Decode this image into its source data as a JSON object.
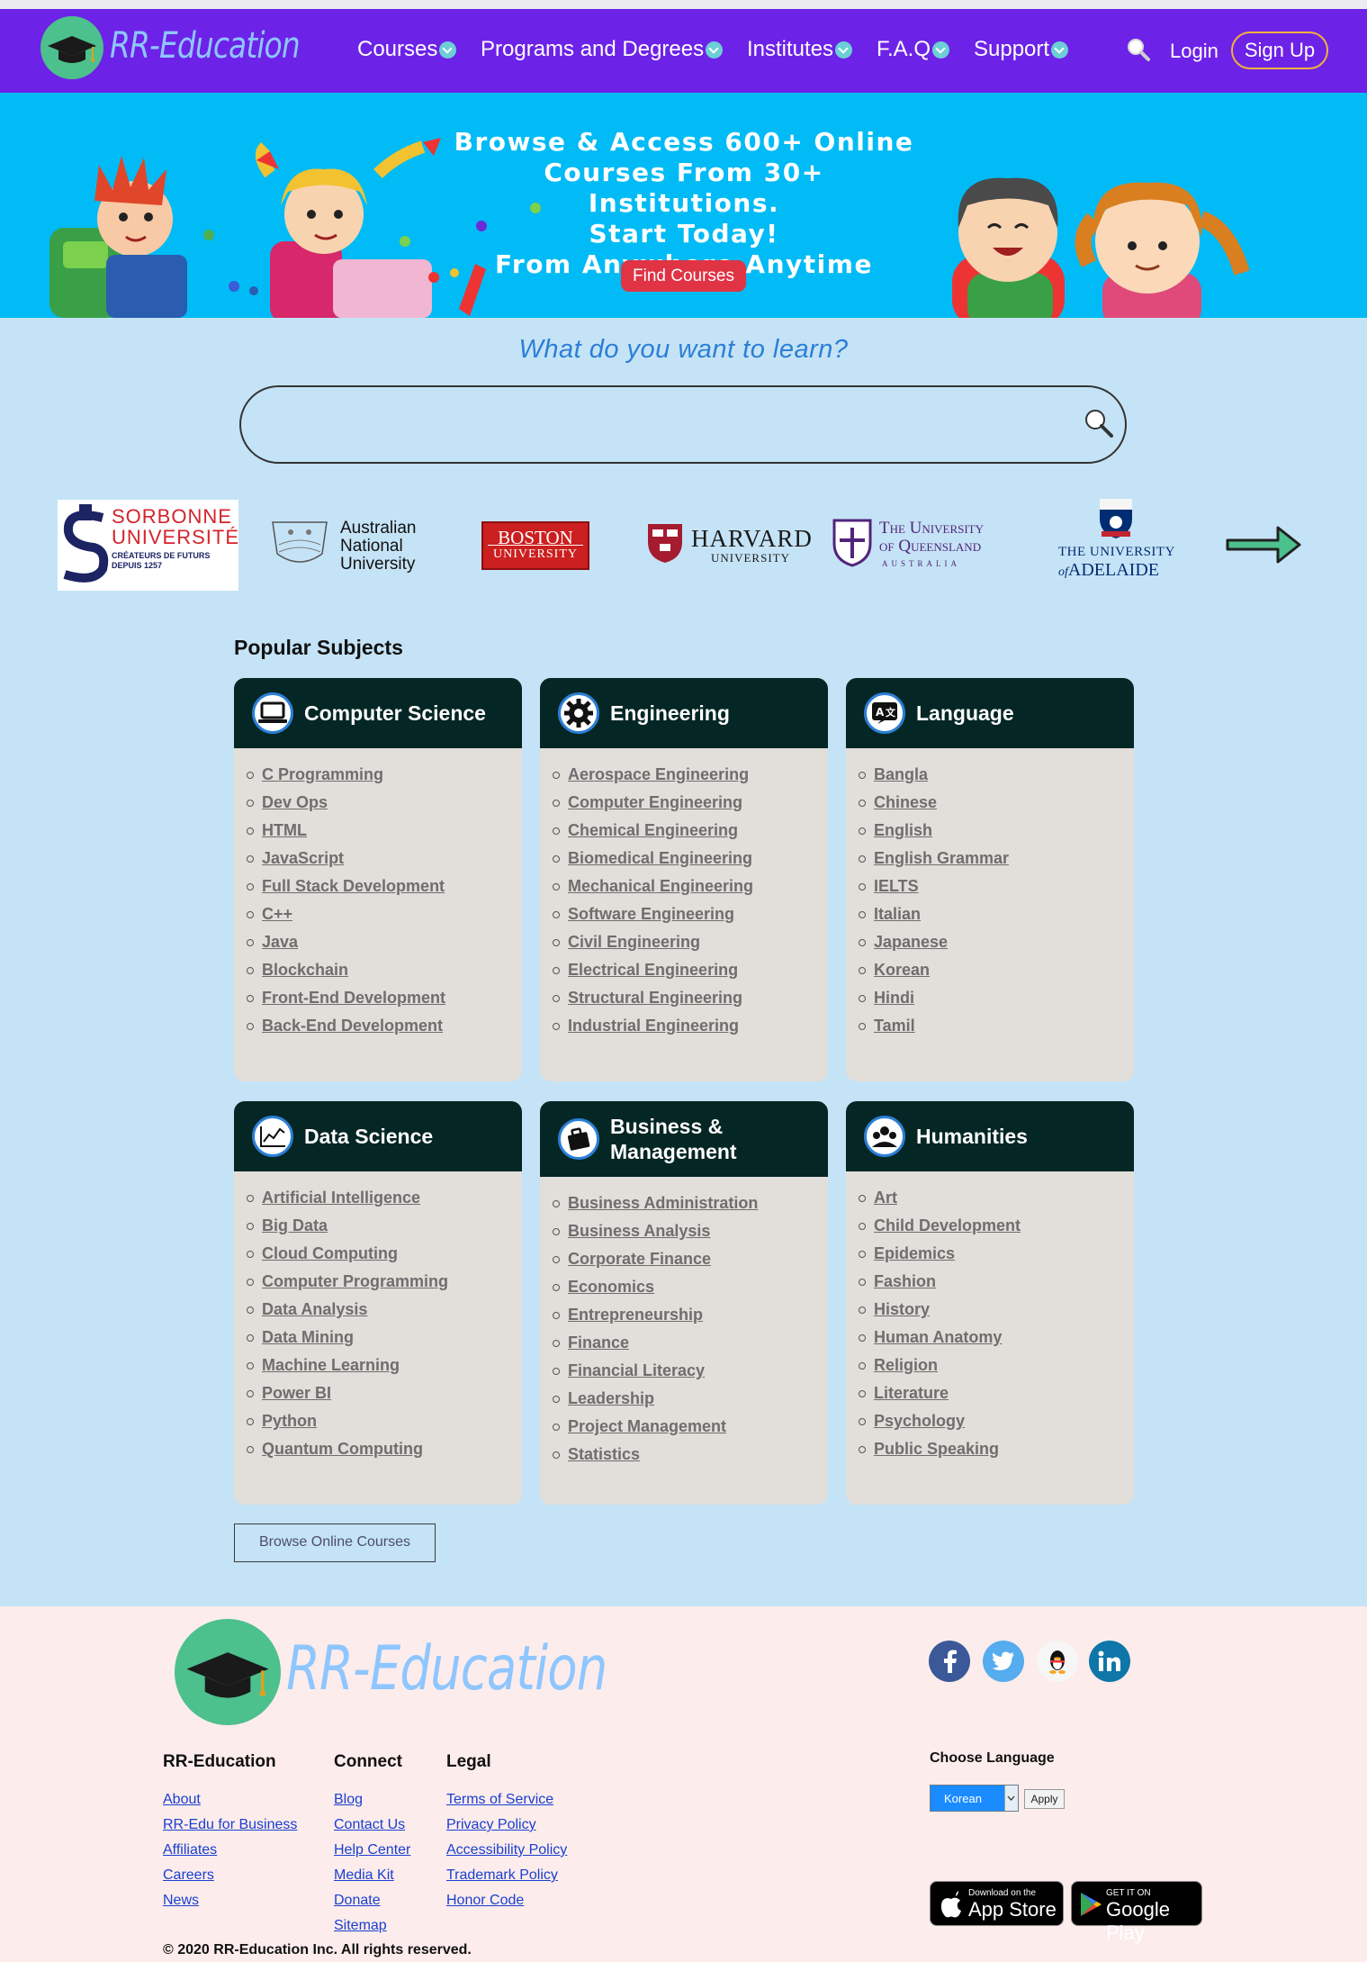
{
  "brand": {
    "name": "RR-Education"
  },
  "nav": {
    "items": [
      "Courses",
      "Programs and Degrees",
      "Institutes",
      "F.A.Q",
      "Support"
    ],
    "login": "Login",
    "signup": "Sign Up"
  },
  "hero": {
    "line1": "Browse & Access 600+ Online",
    "line2": "Courses From 30+ Institutions.",
    "line3": "Start Today!",
    "line4": "From Anywhere,Anytime",
    "cta": "Find Courses"
  },
  "learn": {
    "question": "What do you want to learn?",
    "search_value": ""
  },
  "universities": {
    "sorbonne": {
      "line1": "SORBONNE",
      "line2": "UNIVERSITÉ",
      "line3": "CRÉATEURS DE FUTURS",
      "line4": "DEPUIS 1257"
    },
    "anu": {
      "line1": "Australian",
      "line2": "National",
      "line3": "University"
    },
    "boston": {
      "line1": "BOSTON",
      "line2": "UNIVERSITY"
    },
    "harvard": {
      "line1": "HARVARD",
      "line2": "UNIVERSITY"
    },
    "uq": {
      "line1": "The University",
      "line2": "of Queensland",
      "line3": "AUSTRALIA"
    },
    "adelaide": {
      "line1": "THE UNIVERSITY",
      "line2": "of",
      "line3": "ADELAIDE"
    }
  },
  "subjects": {
    "title": "Popular Subjects",
    "cards": [
      {
        "title": "Computer Science",
        "icon": "laptop-icon",
        "items": [
          "C Programming",
          "Dev Ops",
          "HTML",
          "JavaScript",
          "Full Stack Development",
          "C++",
          "Java",
          "Blockchain",
          "Front-End Development",
          "Back-End Development"
        ]
      },
      {
        "title": "Engineering",
        "icon": "gear-icon",
        "items": [
          "Aerospace Engineering",
          "Computer Engineering",
          "Chemical Engineering",
          "Biomedical Engineering",
          "Mechanical Engineering",
          "Software Engineering",
          "Civil Engineering",
          "Electrical Engineering",
          "Structural Engineering",
          "Industrial Engineering"
        ]
      },
      {
        "title": "Language",
        "icon": "translate-icon",
        "items": [
          "Bangla",
          "Chinese",
          "English",
          "English Grammar",
          "IELTS",
          "Italian",
          "Japanese",
          "Korean",
          "Hindi",
          "Tamil"
        ]
      },
      {
        "title": "Data Science",
        "icon": "chart-icon",
        "items": [
          "Artificial Intelligence",
          "Big Data",
          "Cloud Computing",
          "Computer Programming",
          "Data Analysis",
          "Data Mining",
          "Machine Learning",
          "Power BI",
          "Python",
          "Quantum Computing"
        ]
      },
      {
        "title_line1": "Business &",
        "title_line2": "Management",
        "icon": "briefcase-icon",
        "items": [
          "Business Administration",
          "Business Analysis",
          "Corporate Finance",
          "Economics",
          "Entrepreneurship",
          "Finance",
          "Financial Literacy",
          "Leadership",
          "Project Management",
          "Statistics"
        ]
      },
      {
        "title": "Humanities",
        "icon": "people-icon",
        "items": [
          "Art",
          "Child Development",
          "Epidemics",
          "Fashion",
          "History",
          "Human Anatomy",
          "Religion",
          "Literature",
          "Psychology",
          "Public Speaking"
        ]
      }
    ],
    "browse_button": "Browse Online Courses"
  },
  "footer": {
    "brand": "RR-Education",
    "columns": [
      {
        "title": "RR-Education",
        "links": [
          "About",
          "RR-Edu for Business",
          "Affiliates",
          "Careers",
          "News"
        ]
      },
      {
        "title": "Connect",
        "links": [
          "Blog",
          "Contact Us",
          "Help Center",
          "Media Kit",
          "Donate",
          "Sitemap"
        ]
      },
      {
        "title": "Legal",
        "links": [
          "Terms of Service",
          "Privacy Policy",
          "Accessibility Policy",
          "Trademark Policy",
          "Honor Code"
        ]
      }
    ],
    "choose_language": "Choose Language",
    "language_selected": "Korean",
    "apply": "Apply",
    "appstore_small": "Download on the",
    "appstore_big": "App Store",
    "googleplay_small": "GET IT ON",
    "googleplay_big": "Google Play",
    "copyright": "© 2020 RR-Education Inc. All rights reserved."
  },
  "colors": {
    "nav": "#6d22e8",
    "hero": "#00bbf5",
    "page": "#c5e3f6",
    "card_head": "#042624",
    "footer": "#fceceb"
  }
}
